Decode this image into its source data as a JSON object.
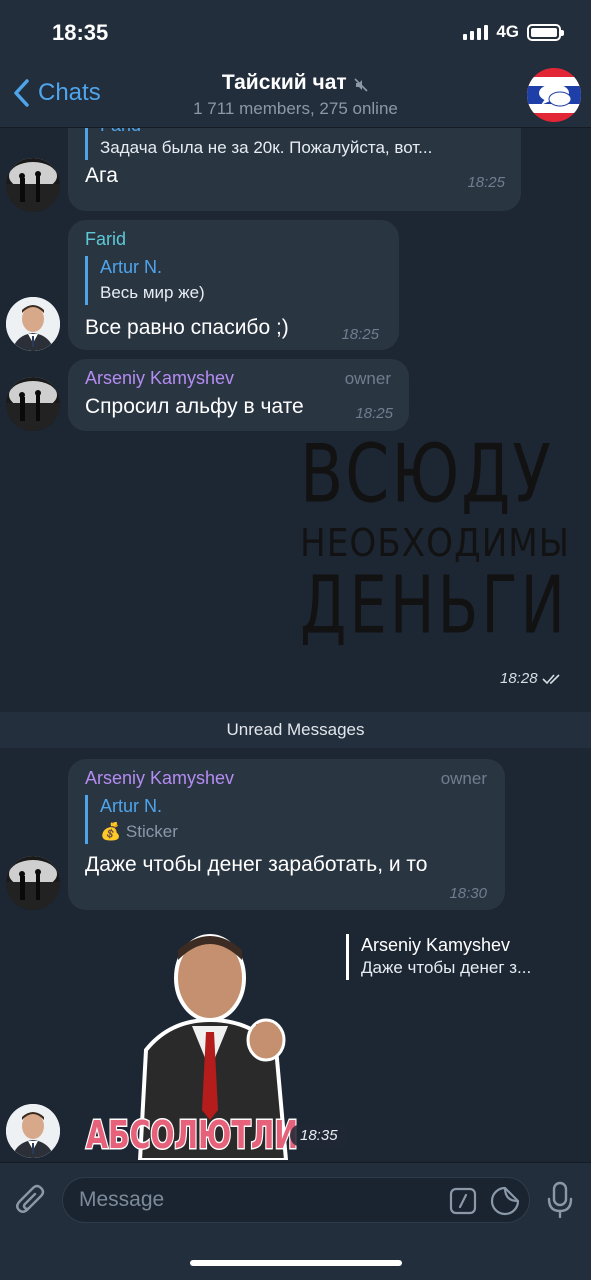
{
  "status_bar": {
    "time": "18:35",
    "network": "4G"
  },
  "header": {
    "back_label": "Chats",
    "title": "Тайский чат",
    "subtitle": "1 711 members, 275 online"
  },
  "messages": [
    {
      "reply_name": "Farid",
      "reply_text": "Задача была не за 20к. Пожалуйста, вот...",
      "text": "Ага",
      "time": "18:25"
    },
    {
      "sender": "Farid",
      "reply_name": "Artur N.",
      "reply_text": "Весь мир же)",
      "text": "Все равно спасибо ;)",
      "time": "18:25"
    },
    {
      "sender": "Arseniy Kamyshev",
      "role": "owner",
      "text": "Спросил альфу в чате",
      "time": "18:25"
    },
    {
      "sticker_lines": [
        "ВСЮДУ",
        "НЕОБХОДИМЫ",
        "ДЕНЬГИ"
      ],
      "time": "18:28"
    }
  ],
  "unread_label": "Unread Messages",
  "unread_messages": [
    {
      "sender": "Arseniy Kamyshev",
      "role": "owner",
      "reply_name": "Artur N.",
      "reply_text": "Sticker",
      "reply_emoji": "💰",
      "text": "Даже чтобы денег заработать, и то",
      "time": "18:30"
    },
    {
      "reply_name": "Arseniy Kamyshev",
      "reply_text": "Даже чтобы денег з...",
      "sticker_caption": "АБСОЛЮТЛИ",
      "time": "18:35"
    }
  ],
  "input": {
    "placeholder": "Message"
  },
  "colors": {
    "background": "#1d2733",
    "bubble": "#2a3542",
    "accent": "#4fa5ec",
    "farid": "#5ec9d6",
    "arseniy": "#b48cf2",
    "muted": "#6f7e8e"
  },
  "icons": [
    "chevron-left-icon",
    "mute-icon",
    "attach-icon",
    "command-icon",
    "sticker-icon",
    "microphone-icon",
    "double-check-icon"
  ]
}
